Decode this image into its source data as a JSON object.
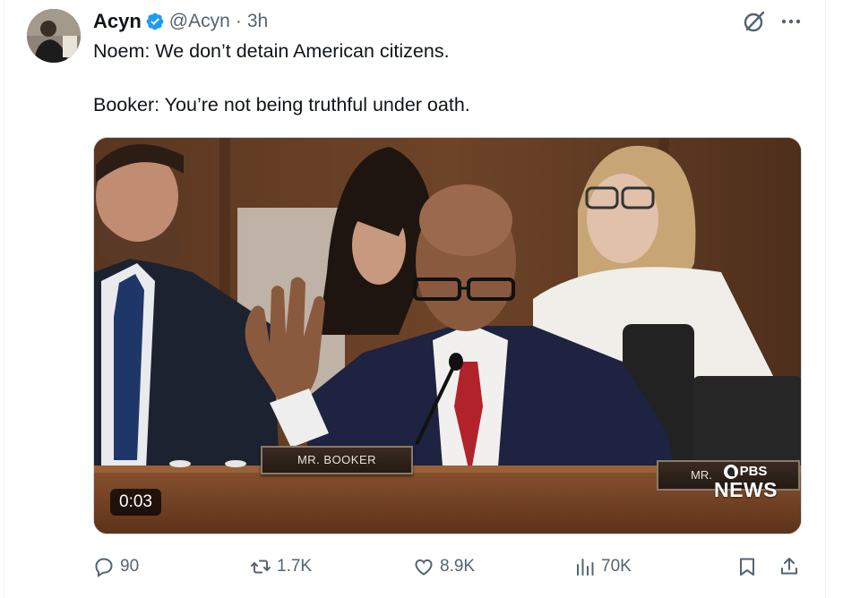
{
  "tweet": {
    "author_name": "Acyn",
    "handle": "@Acyn",
    "separator": "·",
    "time": "3h",
    "text": "Noem: We don’t detain American citizens.\n\nBooker: You’re not being truthful under oath."
  },
  "media": {
    "duration": "0:03",
    "nameplate": "MR. BOOKER",
    "nameplate2": "MR.",
    "watermark_top": "PBS",
    "watermark_bottom": "NEWS"
  },
  "actions": {
    "replies": "90",
    "reposts": "1.7K",
    "likes": "8.9K",
    "views": "70K"
  },
  "colors": {
    "verified": "#1d9bf0",
    "secondary_text": "#536471",
    "primary_text": "#0f1419"
  },
  "icons": [
    "verified-badge-icon",
    "grok-icon",
    "more-icon",
    "reply-icon",
    "retweet-icon",
    "like-icon",
    "views-icon",
    "bookmark-icon",
    "share-icon"
  ]
}
